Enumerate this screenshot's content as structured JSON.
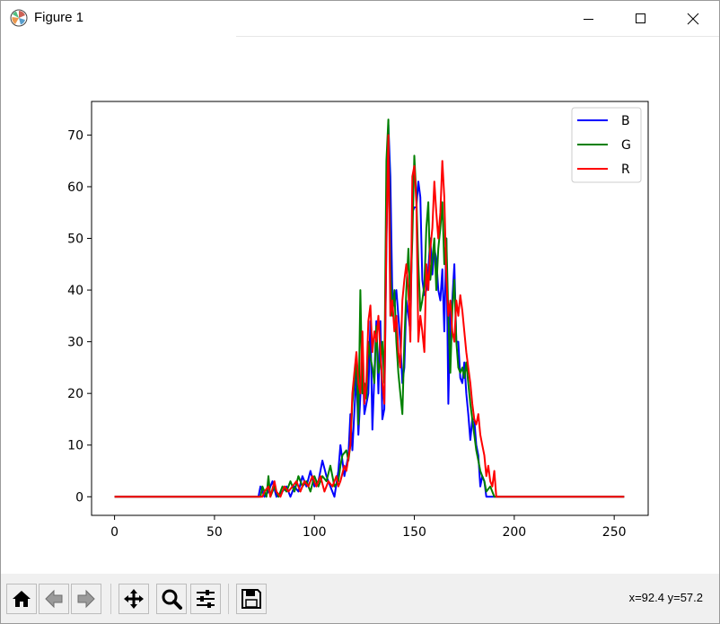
{
  "window": {
    "title": "Figure 1"
  },
  "toolbar": {
    "buttons": [
      {
        "name": "home-button",
        "icon": "home-icon"
      },
      {
        "name": "back-button",
        "icon": "arrow-left-icon"
      },
      {
        "name": "forward-button",
        "icon": "arrow-right-icon"
      },
      {
        "name": "pan-button",
        "icon": "move-icon"
      },
      {
        "name": "zoom-button",
        "icon": "magnifier-icon"
      },
      {
        "name": "configure-subplots-button",
        "icon": "sliders-icon"
      },
      {
        "name": "save-button",
        "icon": "floppy-disk-icon"
      }
    ],
    "coords": "x=92.4 y=57.2"
  },
  "chart_data": {
    "type": "line",
    "title": "",
    "xlabel": "",
    "ylabel": "",
    "xlim": [
      -11.5,
      267
    ],
    "ylim": [
      -3.6,
      76.5
    ],
    "xticks": [
      0,
      50,
      100,
      150,
      200,
      250
    ],
    "yticks": [
      0,
      10,
      20,
      30,
      40,
      50,
      60,
      70
    ],
    "legend": "top-right",
    "grid": false,
    "series": [
      {
        "name": "B",
        "color": "#0000ff",
        "points": [
          [
            0,
            0
          ],
          [
            72,
            0
          ],
          [
            73,
            2
          ],
          [
            75,
            0
          ],
          [
            77,
            1
          ],
          [
            79,
            3
          ],
          [
            81,
            0
          ],
          [
            84,
            1
          ],
          [
            86,
            2
          ],
          [
            88,
            0
          ],
          [
            90,
            2
          ],
          [
            92,
            1
          ],
          [
            94,
            4
          ],
          [
            96,
            2
          ],
          [
            98,
            5
          ],
          [
            100,
            2
          ],
          [
            102,
            3
          ],
          [
            104,
            7
          ],
          [
            106,
            4
          ],
          [
            108,
            2
          ],
          [
            110,
            0
          ],
          [
            112,
            5
          ],
          [
            113,
            10
          ],
          [
            115,
            4
          ],
          [
            117,
            8
          ],
          [
            118,
            16
          ],
          [
            119,
            9
          ],
          [
            121,
            24
          ],
          [
            122,
            12
          ],
          [
            124,
            27
          ],
          [
            125,
            16
          ],
          [
            127,
            20
          ],
          [
            128,
            34
          ],
          [
            129,
            13
          ],
          [
            131,
            34
          ],
          [
            132,
            20
          ],
          [
            133,
            34
          ],
          [
            134,
            15
          ],
          [
            135,
            17
          ],
          [
            136,
            48
          ],
          [
            137,
            72
          ],
          [
            138,
            62
          ],
          [
            139,
            39
          ],
          [
            140,
            37
          ],
          [
            141,
            40
          ],
          [
            142,
            35
          ],
          [
            143,
            30
          ],
          [
            144,
            22
          ],
          [
            145,
            25
          ],
          [
            146,
            38
          ],
          [
            147,
            35
          ],
          [
            148,
            32
          ],
          [
            149,
            55
          ],
          [
            150,
            56
          ],
          [
            151,
            56
          ],
          [
            152,
            61
          ],
          [
            153,
            58
          ],
          [
            154,
            42
          ],
          [
            155,
            39
          ],
          [
            156,
            40
          ],
          [
            157,
            44
          ],
          [
            158,
            50
          ],
          [
            159,
            43
          ],
          [
            160,
            48
          ],
          [
            161,
            46
          ],
          [
            162,
            40
          ],
          [
            163,
            38
          ],
          [
            164,
            44
          ],
          [
            165,
            32
          ],
          [
            166,
            50
          ],
          [
            167,
            18
          ],
          [
            168,
            36
          ],
          [
            169,
            38
          ],
          [
            170,
            45
          ],
          [
            171,
            30
          ],
          [
            172,
            30
          ],
          [
            173,
            23
          ],
          [
            174,
            22
          ],
          [
            175,
            26
          ],
          [
            176,
            20
          ],
          [
            177,
            16
          ],
          [
            178,
            11
          ],
          [
            179,
            15
          ],
          [
            180,
            15
          ],
          [
            181,
            10
          ],
          [
            182,
            8
          ],
          [
            183,
            2
          ],
          [
            184,
            4
          ],
          [
            185,
            3
          ],
          [
            186,
            0
          ],
          [
            190,
            0
          ],
          [
            255,
            0
          ]
        ]
      },
      {
        "name": "G",
        "color": "#008000",
        "points": [
          [
            0,
            0
          ],
          [
            73,
            0
          ],
          [
            74,
            2
          ],
          [
            76,
            0
          ],
          [
            77,
            4
          ],
          [
            78,
            0
          ],
          [
            80,
            2
          ],
          [
            82,
            0
          ],
          [
            84,
            2
          ],
          [
            86,
            1
          ],
          [
            88,
            3
          ],
          [
            90,
            1
          ],
          [
            92,
            4
          ],
          [
            94,
            2
          ],
          [
            96,
            3
          ],
          [
            98,
            1
          ],
          [
            100,
            4
          ],
          [
            102,
            2
          ],
          [
            104,
            4
          ],
          [
            106,
            3
          ],
          [
            108,
            6
          ],
          [
            110,
            2
          ],
          [
            112,
            3
          ],
          [
            113,
            6
          ],
          [
            114,
            8
          ],
          [
            116,
            9
          ],
          [
            117,
            7
          ],
          [
            118,
            10
          ],
          [
            119,
            18
          ],
          [
            120,
            22
          ],
          [
            121,
            27
          ],
          [
            122,
            14
          ],
          [
            123,
            40
          ],
          [
            124,
            20
          ],
          [
            125,
            22
          ],
          [
            126,
            19
          ],
          [
            127,
            30
          ],
          [
            128,
            27
          ],
          [
            129,
            25
          ],
          [
            130,
            22
          ],
          [
            131,
            33
          ],
          [
            132,
            24
          ],
          [
            133,
            26
          ],
          [
            134,
            30
          ],
          [
            135,
            22
          ],
          [
            136,
            65
          ],
          [
            137,
            73
          ],
          [
            138,
            44
          ],
          [
            139,
            35
          ],
          [
            140,
            40
          ],
          [
            141,
            30
          ],
          [
            142,
            24
          ],
          [
            143,
            20
          ],
          [
            144,
            16
          ],
          [
            145,
            30
          ],
          [
            146,
            40
          ],
          [
            147,
            48
          ],
          [
            148,
            38
          ],
          [
            149,
            50
          ],
          [
            150,
            66
          ],
          [
            151,
            58
          ],
          [
            152,
            45
          ],
          [
            153,
            36
          ],
          [
            154,
            38
          ],
          [
            155,
            41
          ],
          [
            156,
            52
          ],
          [
            157,
            57
          ],
          [
            158,
            42
          ],
          [
            159,
            46
          ],
          [
            160,
            50
          ],
          [
            161,
            40
          ],
          [
            162,
            48
          ],
          [
            163,
            52
          ],
          [
            164,
            57
          ],
          [
            165,
            45
          ],
          [
            166,
            50
          ],
          [
            167,
            35
          ],
          [
            168,
            24
          ],
          [
            169,
            36
          ],
          [
            170,
            42
          ],
          [
            171,
            30
          ],
          [
            172,
            25
          ],
          [
            173,
            24
          ],
          [
            174,
            25
          ],
          [
            175,
            23
          ],
          [
            176,
            26
          ],
          [
            177,
            22
          ],
          [
            178,
            18
          ],
          [
            179,
            15
          ],
          [
            180,
            12
          ],
          [
            181,
            9
          ],
          [
            182,
            7
          ],
          [
            183,
            5
          ],
          [
            184,
            4
          ],
          [
            185,
            3
          ],
          [
            186,
            1
          ],
          [
            188,
            2
          ],
          [
            190,
            0
          ],
          [
            255,
            0
          ]
        ]
      },
      {
        "name": "R",
        "color": "#ff0000",
        "points": [
          [
            0,
            0
          ],
          [
            74,
            0
          ],
          [
            75,
            1
          ],
          [
            77,
            2
          ],
          [
            78,
            0
          ],
          [
            80,
            3
          ],
          [
            81,
            1
          ],
          [
            83,
            0
          ],
          [
            85,
            2
          ],
          [
            87,
            1
          ],
          [
            89,
            2
          ],
          [
            91,
            3
          ],
          [
            93,
            1
          ],
          [
            95,
            3
          ],
          [
            97,
            2
          ],
          [
            99,
            4
          ],
          [
            101,
            2
          ],
          [
            103,
            4
          ],
          [
            105,
            1
          ],
          [
            107,
            3
          ],
          [
            109,
            2
          ],
          [
            111,
            4
          ],
          [
            112,
            2
          ],
          [
            113,
            3
          ],
          [
            115,
            6
          ],
          [
            116,
            5
          ],
          [
            118,
            10
          ],
          [
            119,
            20
          ],
          [
            120,
            24
          ],
          [
            121,
            28
          ],
          [
            122,
            22
          ],
          [
            123,
            20
          ],
          [
            124,
            32
          ],
          [
            125,
            18
          ],
          [
            126,
            22
          ],
          [
            127,
            34
          ],
          [
            128,
            37
          ],
          [
            129,
            28
          ],
          [
            130,
            32
          ],
          [
            131,
            30
          ],
          [
            132,
            35
          ],
          [
            133,
            28
          ],
          [
            134,
            22
          ],
          [
            135,
            18
          ],
          [
            136,
            50
          ],
          [
            137,
            70
          ],
          [
            138,
            35
          ],
          [
            139,
            38
          ],
          [
            140,
            32
          ],
          [
            141,
            35
          ],
          [
            142,
            28
          ],
          [
            143,
            25
          ],
          [
            144,
            38
          ],
          [
            145,
            42
          ],
          [
            146,
            45
          ],
          [
            147,
            40
          ],
          [
            148,
            30
          ],
          [
            149,
            62
          ],
          [
            150,
            64
          ],
          [
            151,
            57
          ],
          [
            152,
            30
          ],
          [
            153,
            35
          ],
          [
            154,
            32
          ],
          [
            155,
            28
          ],
          [
            156,
            45
          ],
          [
            157,
            40
          ],
          [
            158,
            48
          ],
          [
            159,
            52
          ],
          [
            160,
            61
          ],
          [
            161,
            55
          ],
          [
            162,
            50
          ],
          [
            163,
            55
          ],
          [
            164,
            65
          ],
          [
            165,
            58
          ],
          [
            166,
            42
          ],
          [
            167,
            35
          ],
          [
            168,
            38
          ],
          [
            169,
            32
          ],
          [
            170,
            30
          ],
          [
            171,
            38
          ],
          [
            172,
            35
          ],
          [
            173,
            39
          ],
          [
            174,
            36
          ],
          [
            175,
            32
          ],
          [
            176,
            28
          ],
          [
            177,
            25
          ],
          [
            178,
            22
          ],
          [
            179,
            18
          ],
          [
            180,
            15
          ],
          [
            181,
            14
          ],
          [
            182,
            16
          ],
          [
            183,
            12
          ],
          [
            184,
            10
          ],
          [
            185,
            8
          ],
          [
            186,
            4
          ],
          [
            187,
            6
          ],
          [
            188,
            3
          ],
          [
            189,
            2
          ],
          [
            190,
            5
          ],
          [
            191,
            0
          ],
          [
            255,
            0
          ]
        ]
      }
    ]
  }
}
